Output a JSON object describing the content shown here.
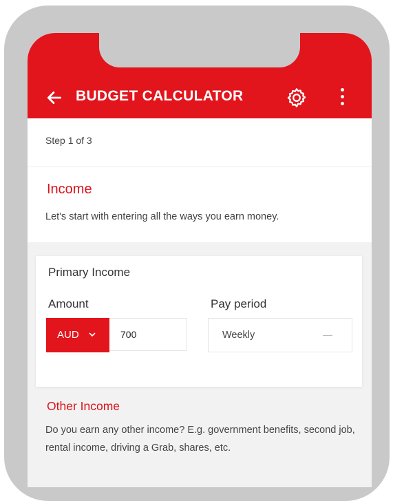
{
  "header": {
    "title": "BUDGET CALCULATOR",
    "icons": [
      "back-arrow-icon",
      "gear-icon",
      "more-vertical-icon"
    ]
  },
  "step": {
    "label": "Step 1 of 3"
  },
  "income": {
    "title": "Income",
    "description": "Let's start with entering all the ways you earn money."
  },
  "primary_income": {
    "title": "Primary Income",
    "amount_label": "Amount",
    "currency": "AUD",
    "amount_value": "700",
    "pay_period_label": "Pay period",
    "pay_period_value": "Weekly"
  },
  "other_income": {
    "title": "Other Income",
    "description": "Do you earn any other income? E.g. government benefits, second job, rental income, driving a Grab, shares, etc."
  },
  "colors": {
    "accent": "#e2141c",
    "frame": "#c9c9c9",
    "band": "#f2f2f2"
  }
}
